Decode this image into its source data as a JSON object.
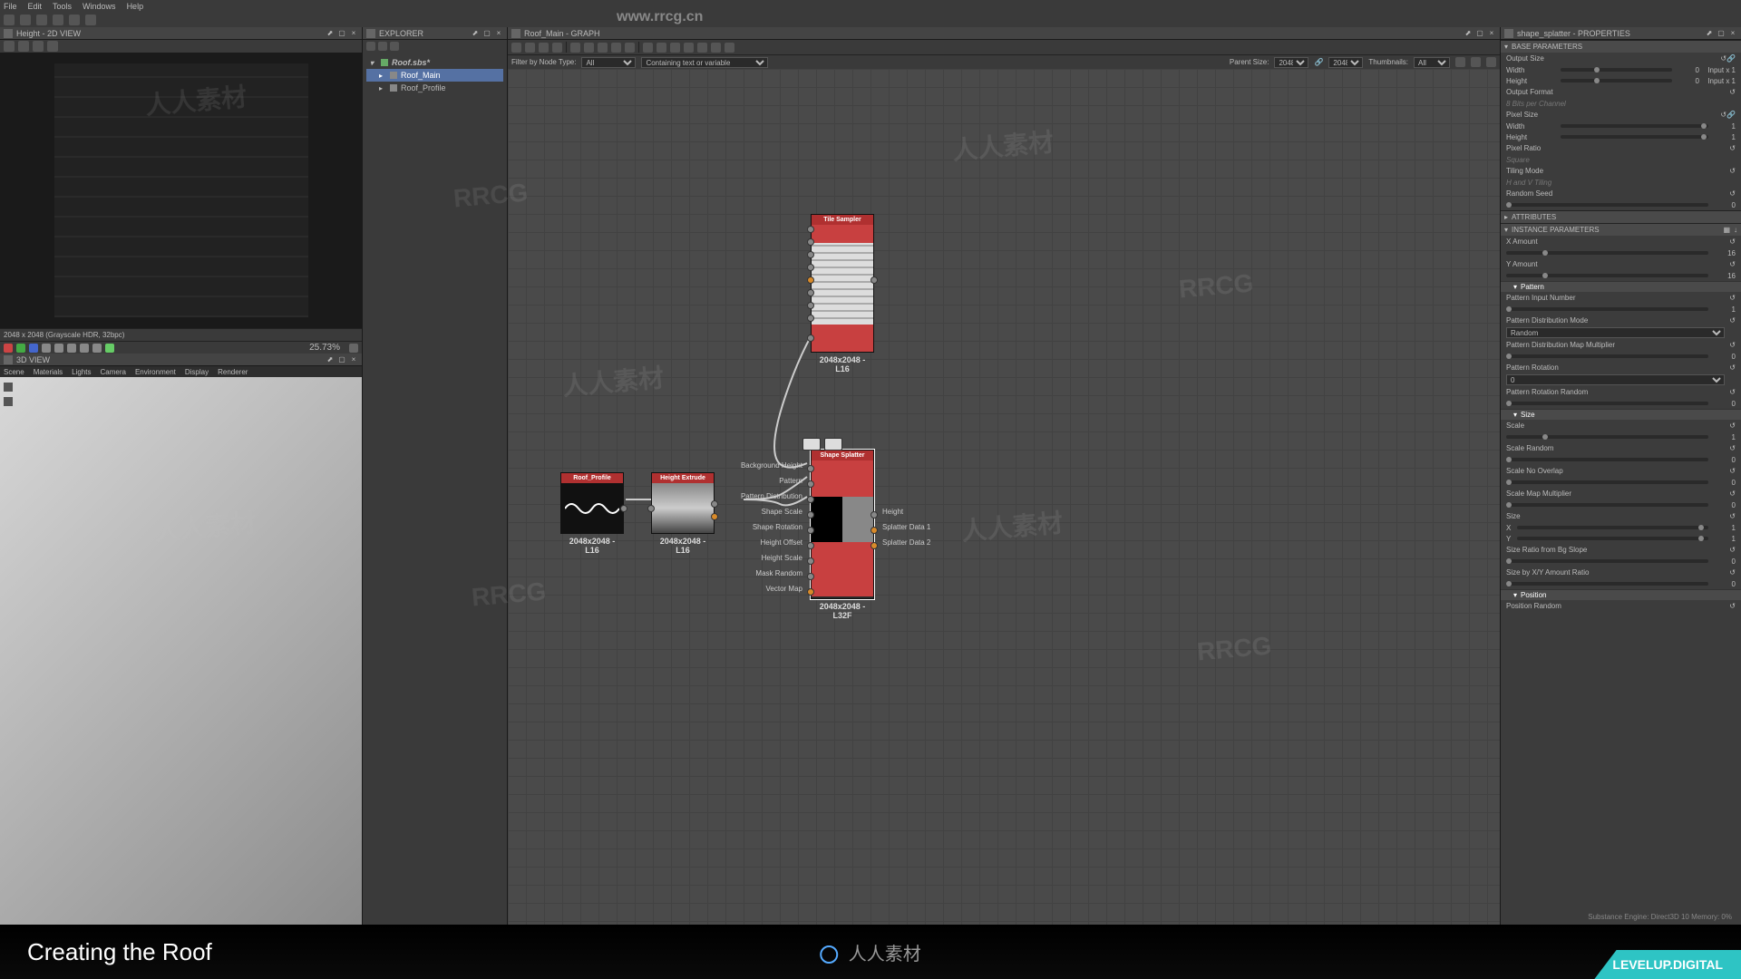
{
  "menubar": [
    "File",
    "Edit",
    "Tools",
    "Windows",
    "Help"
  ],
  "watermark_url": "www.rrcg.cn",
  "panels": {
    "view2d": {
      "title": "Height - 2D VIEW",
      "status": "2048 x 2048 (Grayscale HDR, 32bpc)",
      "zoom": "25.73%"
    },
    "view3d": {
      "title": "3D VIEW",
      "menu": [
        "Scene",
        "Materials",
        "Lights",
        "Camera",
        "Environment",
        "Display",
        "Renderer"
      ]
    },
    "explorer": {
      "title": "EXPLORER",
      "root": "Roof.sbs*",
      "items": [
        {
          "label": "Roof_Main",
          "selected": true
        },
        {
          "label": "Roof_Profile",
          "selected": false
        }
      ]
    },
    "graph": {
      "title": "Roof_Main - GRAPH",
      "filter": {
        "label1": "Filter by Node Type:",
        "type_val": "All",
        "contain_val": "Containing text or variable",
        "parent_label": "Parent Size:",
        "parent_val": "2048",
        "size2": "2048",
        "thumb_label": "Thumbnails:",
        "thumb_val": "All"
      },
      "nodes": {
        "roof_profile": {
          "title": "Roof_Profile",
          "caption": "2048x2048 - L16"
        },
        "height_extrude": {
          "title": "Height Extrude",
          "caption": "2048x2048 - L16"
        },
        "tile_sampler": {
          "title": "Tile Sampler",
          "caption": "2048x2048 - L16"
        },
        "shape_splatter": {
          "title": "Shape Splatter",
          "caption": "2048x2048 - L32F",
          "inputs": [
            "Background Height",
            "Pattern",
            "Pattern Distribution",
            "Shape Scale",
            "Shape Rotation",
            "Height Offset",
            "Height Scale",
            "Mask Random",
            "Vector Map"
          ],
          "outputs": [
            "Height",
            "Splatter Data 1",
            "Splatter Data 2"
          ]
        }
      }
    },
    "properties": {
      "title": "shape_splatter - PROPERTIES",
      "sections": {
        "base": {
          "header": "BASE PARAMETERS",
          "output_size": "Output Size",
          "width": "Width",
          "height": "Height",
          "width_val": "0",
          "height_val": "0",
          "width_mult": "Input x 1",
          "height_mult": "Input x 1",
          "output_format": "Output Format",
          "format_val": "8 Bits per Channel",
          "pixel_size": "Pixel Size",
          "pixel_ratio": "Pixel Ratio",
          "ratio_val": "Square",
          "tiling": "Tiling Mode",
          "tiling_val": "H and V Tiling",
          "seed": "Random Seed",
          "seed_val": "0"
        },
        "attributes": "ATTRIBUTES",
        "instance": {
          "header": "INSTANCE PARAMETERS",
          "xamount": {
            "label": "X Amount",
            "val": "16"
          },
          "yamount": {
            "label": "Y Amount",
            "val": "16"
          },
          "pattern_hdr": "Pattern",
          "pattern_input": {
            "label": "Pattern Input Number",
            "val": "1"
          },
          "pattern_dist": {
            "label": "Pattern Distribution Mode",
            "val": "Random"
          },
          "pattern_mult": {
            "label": "Pattern Distribution Map Multiplier",
            "val": "0"
          },
          "pattern_rot": {
            "label": "Pattern Rotation",
            "val": "0"
          },
          "pattern_rot_rand": {
            "label": "Pattern Rotation Random",
            "val": "0"
          },
          "size_hdr": "Size",
          "scale": {
            "label": "Scale",
            "val": "1"
          },
          "scale_rand": {
            "label": "Scale Random",
            "val": "0"
          },
          "scale_noovl": {
            "label": "Scale No Overlap",
            "val": "0"
          },
          "scale_map": {
            "label": "Scale Map Multiplier",
            "val": "0"
          },
          "size": {
            "label": "Size",
            "x": "X",
            "y": "Y",
            "xv": "1",
            "yv": "1"
          },
          "size_ratio_slope": {
            "label": "Size Ratio from Bg Slope",
            "val": "0"
          },
          "size_ratio_xy": {
            "label": "Size by X/Y Amount Ratio",
            "val": "0"
          },
          "position_hdr": "Position",
          "pos_rand": "Position Random"
        }
      }
    }
  },
  "engine_status": "Substance Engine: Direct3D 10   Memory: 0%",
  "footer": {
    "title": "Creating the Roof",
    "center": "人人素材",
    "badge": "LEVELUP.DIGITAL"
  }
}
